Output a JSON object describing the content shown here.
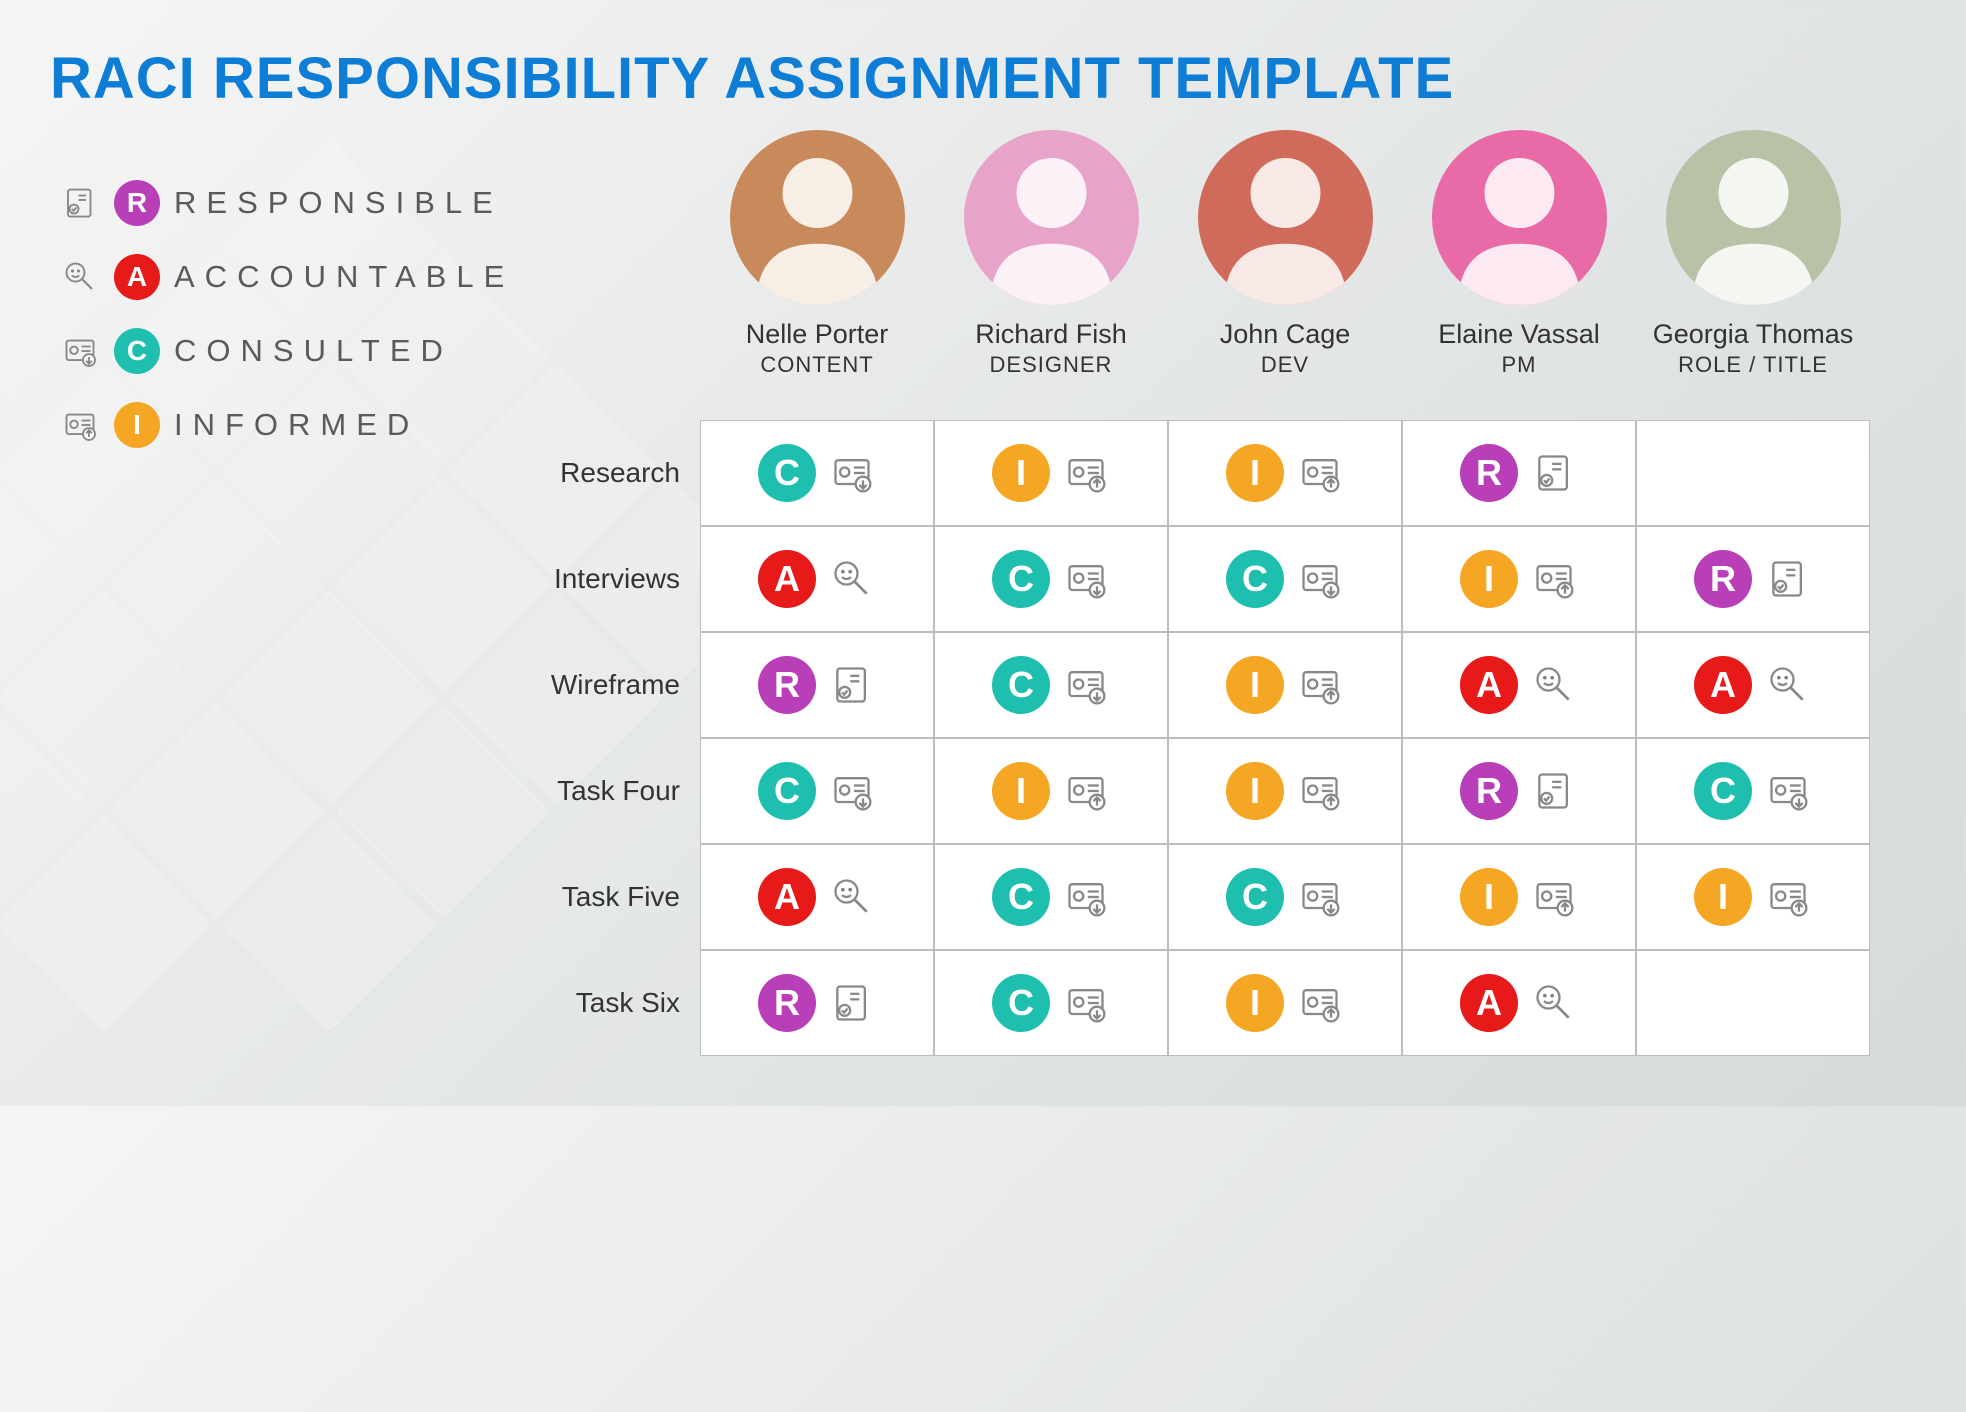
{
  "title": "RACI RESPONSIBILITY ASSIGNMENT TEMPLATE",
  "legend": [
    {
      "letter": "R",
      "label": "RESPONSIBLE",
      "color": "#b83fb8",
      "icon": "doc-check"
    },
    {
      "letter": "A",
      "label": "ACCOUNTABLE",
      "color": "#e71919",
      "icon": "face-magnify"
    },
    {
      "letter": "C",
      "label": "CONSULTED",
      "color": "#1fbfb0",
      "icon": "id-down"
    },
    {
      "letter": "I",
      "label": "INFORMED",
      "color": "#f5a623",
      "icon": "id-up"
    }
  ],
  "people": [
    {
      "name": "Nelle Porter",
      "role": "CONTENT",
      "avatar_bg": "#c98a5b"
    },
    {
      "name": "Richard Fish",
      "role": "DESIGNER",
      "avatar_bg": "#e7a3c9"
    },
    {
      "name": "John Cage",
      "role": "DEV",
      "avatar_bg": "#d06a5a"
    },
    {
      "name": "Elaine Vassal",
      "role": "PM",
      "avatar_bg": "#e86aa6"
    },
    {
      "name": "Georgia Thomas",
      "role": "ROLE / TITLE",
      "avatar_bg": "#b7c2a6"
    }
  ],
  "tasks": [
    "Research",
    "Interviews",
    "Wireframe",
    "Task Four",
    "Task Five",
    "Task Six"
  ],
  "matrix": [
    [
      "C",
      "I",
      "I",
      "R",
      ""
    ],
    [
      "A",
      "C",
      "C",
      "I",
      "R"
    ],
    [
      "R",
      "C",
      "I",
      "A",
      "A"
    ],
    [
      "C",
      "I",
      "I",
      "R",
      "C"
    ],
    [
      "A",
      "C",
      "C",
      "I",
      "I"
    ],
    [
      "R",
      "C",
      "I",
      "A",
      ""
    ]
  ],
  "icon_for": {
    "R": "doc-check",
    "A": "face-magnify",
    "C": "id-down",
    "I": "id-up"
  }
}
